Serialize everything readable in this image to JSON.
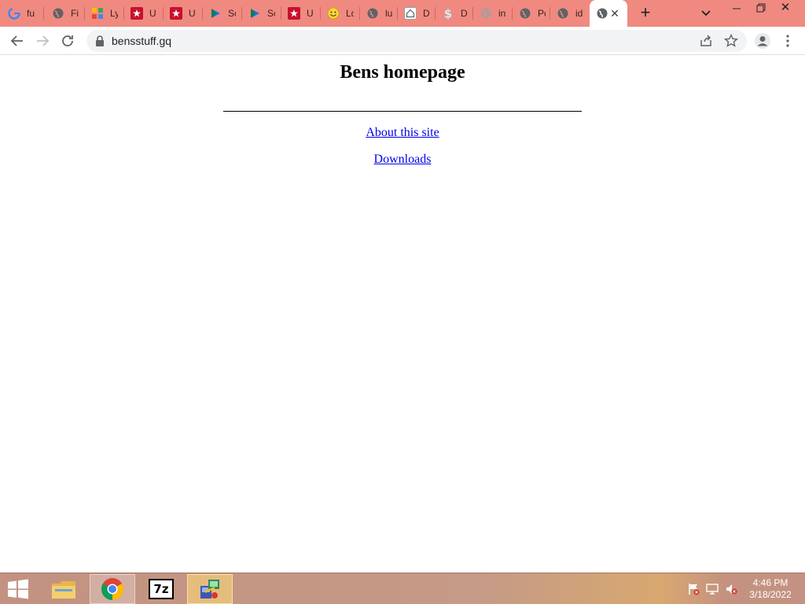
{
  "browser": {
    "tabs": [
      {
        "title": "fu",
        "icon": "google-icon"
      },
      {
        "title": "Fi",
        "icon": "globe-icon"
      },
      {
        "title": "Ly",
        "icon": "colorful-grid-icon"
      },
      {
        "title": "U",
        "icon": "red-star-icon"
      },
      {
        "title": "U",
        "icon": "red-star-icon"
      },
      {
        "title": "Sc",
        "icon": "play-arrow-icon"
      },
      {
        "title": "Sc",
        "icon": "play-arrow-icon"
      },
      {
        "title": "U",
        "icon": "red-star-icon"
      },
      {
        "title": "Lo",
        "icon": "smiley-icon"
      },
      {
        "title": "lu",
        "icon": "globe-icon"
      },
      {
        "title": "D",
        "icon": "house-outline-icon"
      },
      {
        "title": "D",
        "icon": "dollar-icon"
      },
      {
        "title": "in",
        "icon": "globe-faded-icon"
      },
      {
        "title": "Pc",
        "icon": "globe-icon"
      },
      {
        "title": "id",
        "icon": "globe-icon"
      },
      {
        "title": "",
        "icon": "globe-icon",
        "active": true
      }
    ],
    "address": {
      "url": "bensstuff.gq"
    }
  },
  "page": {
    "title": "Bens homepage",
    "links": [
      {
        "label": "About this site"
      },
      {
        "label": "Downloads"
      }
    ]
  },
  "taskbar": {
    "apps": [
      "file-explorer-icon",
      "chrome-icon",
      "7zip-icon",
      "setup-installer-icon"
    ],
    "sevenzip_label": "7z",
    "clock": {
      "time": "4:46 PM",
      "date": "3/18/2022"
    }
  },
  "colors": {
    "tab_strip": "#f08a80",
    "link": "#0000ee",
    "toolbar_bg": "#ffffff",
    "omnibox_bg": "#f1f3f4"
  }
}
